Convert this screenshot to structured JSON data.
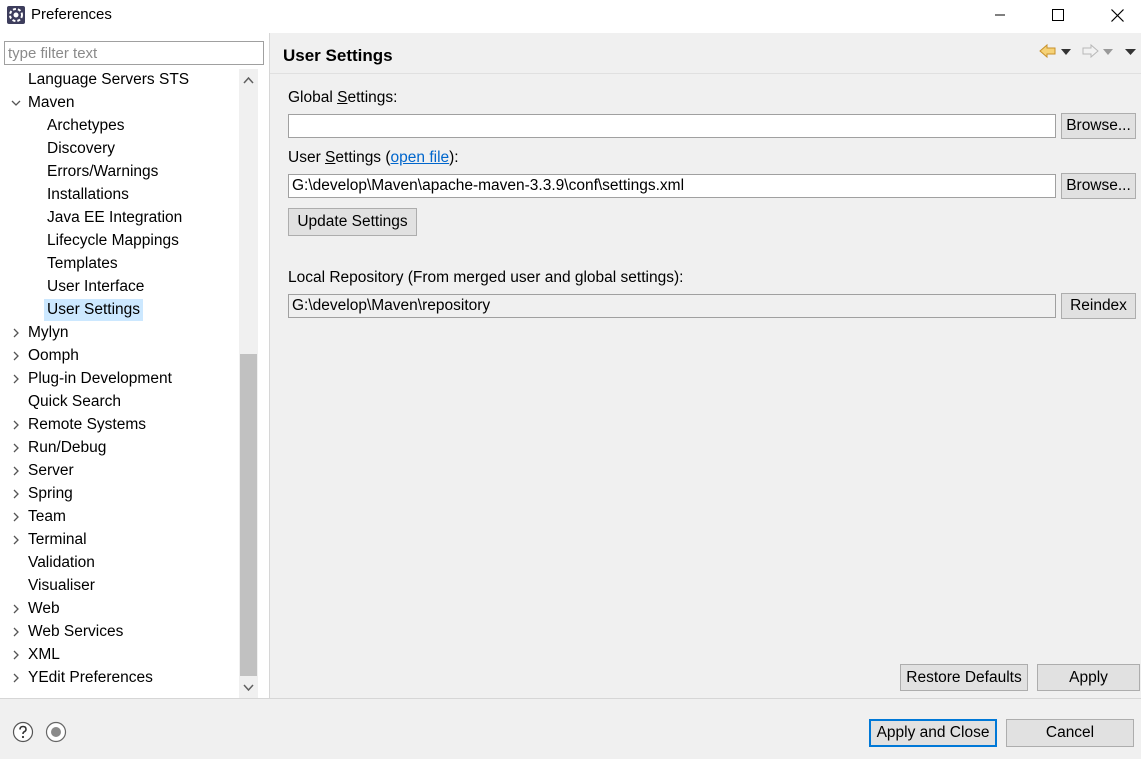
{
  "window": {
    "title": "Preferences",
    "app_icon": "eclipse-gear-icon",
    "controls": {
      "minimize": "minimize-icon",
      "maximize": "maximize-icon",
      "close": "close-icon"
    }
  },
  "sidebar": {
    "filter_placeholder": "type filter text",
    "items": [
      {
        "label": "Language Servers STS",
        "level": 0,
        "expander": "none"
      },
      {
        "label": "Maven",
        "level": 0,
        "expander": "expanded"
      },
      {
        "label": "Archetypes",
        "level": 1,
        "expander": "none"
      },
      {
        "label": "Discovery",
        "level": 1,
        "expander": "none"
      },
      {
        "label": "Errors/Warnings",
        "level": 1,
        "expander": "none"
      },
      {
        "label": "Installations",
        "level": 1,
        "expander": "none"
      },
      {
        "label": "Java EE Integration",
        "level": 1,
        "expander": "none"
      },
      {
        "label": "Lifecycle Mappings",
        "level": 1,
        "expander": "none"
      },
      {
        "label": "Templates",
        "level": 1,
        "expander": "none"
      },
      {
        "label": "User Interface",
        "level": 1,
        "expander": "none"
      },
      {
        "label": "User Settings",
        "level": 1,
        "expander": "none",
        "selected": true
      },
      {
        "label": "Mylyn",
        "level": 0,
        "expander": "collapsed"
      },
      {
        "label": "Oomph",
        "level": 0,
        "expander": "collapsed"
      },
      {
        "label": "Plug-in Development",
        "level": 0,
        "expander": "collapsed"
      },
      {
        "label": "Quick Search",
        "level": 0,
        "expander": "none"
      },
      {
        "label": "Remote Systems",
        "level": 0,
        "expander": "collapsed"
      },
      {
        "label": "Run/Debug",
        "level": 0,
        "expander": "collapsed"
      },
      {
        "label": "Server",
        "level": 0,
        "expander": "collapsed"
      },
      {
        "label": "Spring",
        "level": 0,
        "expander": "collapsed"
      },
      {
        "label": "Team",
        "level": 0,
        "expander": "collapsed"
      },
      {
        "label": "Terminal",
        "level": 0,
        "expander": "collapsed"
      },
      {
        "label": "Validation",
        "level": 0,
        "expander": "none"
      },
      {
        "label": "Visualiser",
        "level": 0,
        "expander": "none"
      },
      {
        "label": "Web",
        "level": 0,
        "expander": "collapsed"
      },
      {
        "label": "Web Services",
        "level": 0,
        "expander": "collapsed"
      },
      {
        "label": "XML",
        "level": 0,
        "expander": "collapsed"
      },
      {
        "label": "YEdit Preferences",
        "level": 0,
        "expander": "collapsed"
      }
    ]
  },
  "main": {
    "title": "User Settings",
    "global_settings": {
      "label_pre": "Global ",
      "label_mnemonic": "S",
      "label_post": "ettings:",
      "value": "",
      "browse_label": "Browse..."
    },
    "user_settings": {
      "label_pre": "User ",
      "label_mnemonic": "S",
      "label_mid": "ettings (",
      "link_text": "open file",
      "label_post": "):",
      "value": "G:\\develop\\Maven\\apache-maven-3.3.9\\conf\\settings.xml",
      "browse_label": "Browse..."
    },
    "update_settings_label": "Update Settings",
    "local_repository": {
      "label": "Local Repository (From merged user and global settings):",
      "value": "G:\\develop\\Maven\\repository",
      "reindex_label": "Reindex"
    },
    "restore_defaults_label": "Restore Defaults",
    "apply_label": "Apply"
  },
  "footer": {
    "apply_close_label": "Apply and Close",
    "cancel_label": "Cancel"
  },
  "colors": {
    "selection": "#cce8ff",
    "link": "#0066cc",
    "panel_bg": "#f0f0f0",
    "default_button_border": "#0078d7",
    "nav_back_arrow": "#e8b33a"
  }
}
